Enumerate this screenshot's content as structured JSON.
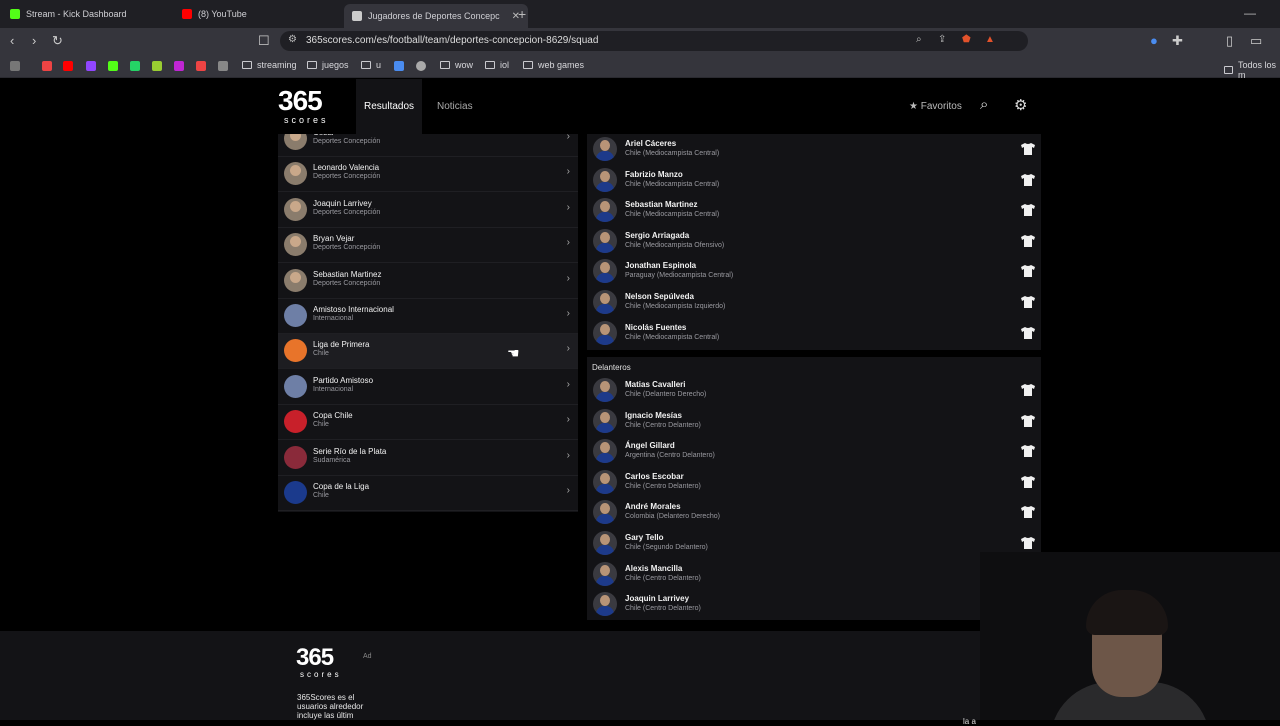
{
  "browser": {
    "tabs": [
      {
        "title": "Stream - Kick Dashboard",
        "fav_color": "#53fc18"
      },
      {
        "title": "(8) YouTube",
        "fav_color": "#ff0000"
      },
      {
        "title": "Jugadores de Deportes Concepc",
        "fav_color": "#cccccc"
      }
    ],
    "url": "365scores.com/es/football/team/deportes-concepcion-8629/squad",
    "bookmarks": [
      "streaming",
      "juegos",
      "u",
      "wow",
      "iol",
      "web games",
      "Todos los m"
    ]
  },
  "site": {
    "logo_big": "365",
    "logo_small": "scores",
    "nav": {
      "results": "Resultados",
      "news": "Noticias"
    },
    "favorites": "Favoritos"
  },
  "competitions": [
    {
      "name": "César",
      "sub": "Deportes Concepción",
      "type": "player"
    },
    {
      "name": "Leonardo Valencia",
      "sub": "Deportes Concepción",
      "type": "player"
    },
    {
      "name": "Joaquin Larrivey",
      "sub": "Deportes Concepción",
      "type": "player"
    },
    {
      "name": "Bryan Vejar",
      "sub": "Deportes Concepción",
      "type": "player"
    },
    {
      "name": "Sebastian Martinez",
      "sub": "Deportes Concepción",
      "type": "player"
    },
    {
      "name": "Amistoso Internacional",
      "sub": "Internacional",
      "type": "crest",
      "color": "#6e7fa6"
    },
    {
      "name": "Liga de Primera",
      "sub": "Chile",
      "type": "crest",
      "color": "#e8742a"
    },
    {
      "name": "Partido Amistoso",
      "sub": "Internacional",
      "type": "crest",
      "color": "#6e7fa6"
    },
    {
      "name": "Copa Chile",
      "sub": "Chile",
      "type": "crest",
      "color": "#c8202a"
    },
    {
      "name": "Serie Río de la Plata",
      "sub": "Sudamérica",
      "type": "crest",
      "color": "#8a2a3a"
    },
    {
      "name": "Copa de la Liga",
      "sub": "Chile",
      "type": "crest",
      "color": "#1b3a8c"
    }
  ],
  "midfielders": [
    {
      "name": "Ariel Cáceres",
      "pos": "Chile (Mediocampista Central)"
    },
    {
      "name": "Fabrizio Manzo",
      "pos": "Chile (Mediocampista Central)"
    },
    {
      "name": "Sebastian Martinez",
      "pos": "Chile (Mediocampista Central)"
    },
    {
      "name": "Sergio Arriagada",
      "pos": "Chile (Mediocampista Ofensivo)"
    },
    {
      "name": "Jonathan Espinola",
      "pos": "Paraguay (Mediocampista Central)"
    },
    {
      "name": "Nelson Sepúlveda",
      "pos": "Chile (Mediocampista Izquierdo)"
    },
    {
      "name": "Nicolás Fuentes",
      "pos": "Chile (Mediocampista Central)"
    }
  ],
  "forwards_title": "Delanteros",
  "forwards": [
    {
      "name": "Matias Cavalleri",
      "pos": "Chile (Delantero Derecho)"
    },
    {
      "name": "Ignacio Mesías",
      "pos": "Chile (Centro Delantero)"
    },
    {
      "name": "Ángel Gillard",
      "pos": "Argentina (Centro Delantero)"
    },
    {
      "name": "Carlos Escobar",
      "pos": "Chile (Centro Delantero)"
    },
    {
      "name": "André Morales",
      "pos": "Colombia (Delantero Derecho)"
    },
    {
      "name": "Gary Tello",
      "pos": "Chile (Segundo Delantero)"
    },
    {
      "name": "Alexis Mancilla",
      "pos": "Chile (Centro Delantero)"
    },
    {
      "name": "Joaquin Larrivey",
      "pos": "Chile (Centro Delantero)"
    }
  ],
  "footer": {
    "ad": "Ad",
    "text": "365Scores es el usuarios alrededor incluye las últim",
    "right": "la a"
  }
}
